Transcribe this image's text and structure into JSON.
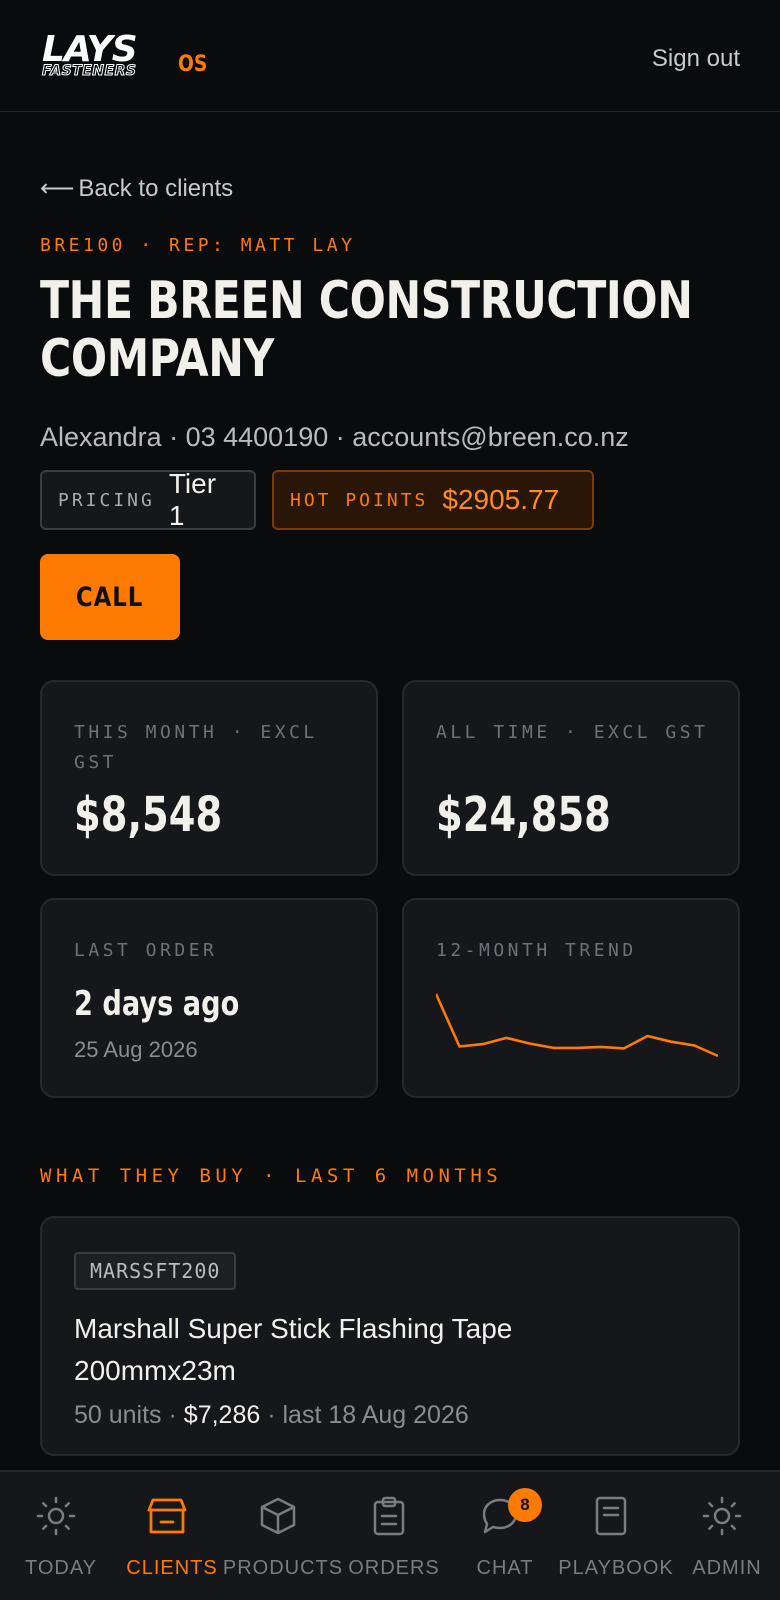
{
  "header": {
    "logo_main": "LAYS",
    "logo_sub": "FASTENERS",
    "logo_suffix": "OS",
    "sign_out": "Sign out"
  },
  "back_link": "Back to clients",
  "client": {
    "code_line": "BRE100 · REP: MATT LAY",
    "name": "THE BREEN CONSTRUCTION COMPANY",
    "contact": "Alexandra · 03 4400190 · accounts@breen.co.nz",
    "pricing_label": "PRICING",
    "pricing_value": "Tier 1",
    "hot_points_label": "HOT POINTS",
    "hot_points_value": "$2905.77",
    "call_label": "CALL"
  },
  "stats": {
    "this_month_label": "THIS MONTH · EXCL GST",
    "this_month_value": "$8,548",
    "all_time_label": "ALL TIME · EXCL GST",
    "all_time_value": "$24,858",
    "last_order_label": "LAST ORDER",
    "last_order_value": "2 days ago",
    "last_order_date": "25 Aug 2026",
    "trend_label": "12-MONTH TREND"
  },
  "chart_data": {
    "type": "line",
    "title": "12-MONTH TREND",
    "xlabel": "",
    "ylabel": "",
    "grid": false,
    "legend": "none",
    "color": "#ff7a00",
    "values": [
      2400,
      1300,
      1350,
      1480,
      1360,
      1270,
      1270,
      1290,
      1260,
      1520,
      1400,
      1320,
      1100
    ]
  },
  "buys": {
    "heading": "WHAT THEY BUY · LAST 6 MONTHS",
    "items": [
      {
        "sku": "MARSSFT200",
        "name": "Marshall Super Stick Flashing Tape 200mmx23m",
        "units": "50 units ·",
        "amount": "$7,286",
        "last": "· last 18 Aug 2026"
      }
    ]
  },
  "nav": {
    "items": [
      {
        "label": "TODAY",
        "icon": "sun-icon"
      },
      {
        "label": "CLIENTS",
        "icon": "store-icon"
      },
      {
        "label": "PRODUCTS",
        "icon": "box-icon"
      },
      {
        "label": "ORDERS",
        "icon": "clipboard-icon"
      },
      {
        "label": "CHAT",
        "icon": "chat-bubble-icon"
      },
      {
        "label": "PLAYBOOK",
        "icon": "book-icon"
      },
      {
        "label": "ADMIN",
        "icon": "sun-icon"
      }
    ],
    "active": "CLIENTS",
    "chat_badge": "8"
  },
  "colors": {
    "accent": "#ff7a00",
    "background": "#0a0b0d",
    "card": "#16171a"
  }
}
